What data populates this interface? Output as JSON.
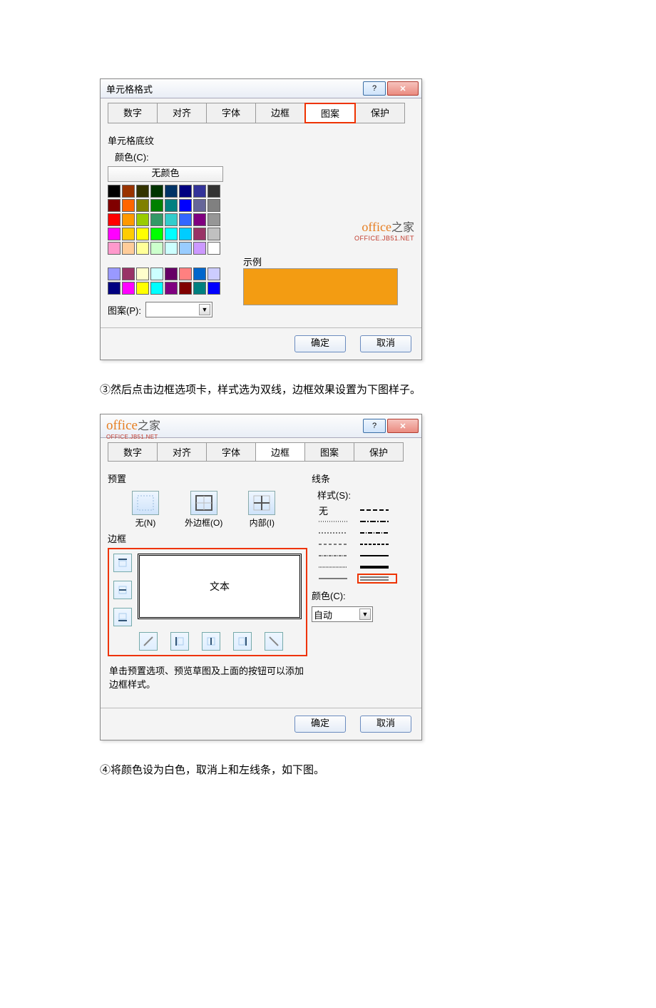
{
  "dialog1": {
    "title": "单元格格式",
    "tabs": [
      "数字",
      "对齐",
      "字体",
      "边框",
      "图案",
      "保护"
    ],
    "activeTab": "图案",
    "shading_label": "单元格底纹",
    "color_label": "颜色(C):",
    "no_color_label": "无颜色",
    "pattern_label": "图案(P):",
    "example_label": "示例",
    "example_color": "#f39c12",
    "selected_swatch": "#f39c12",
    "ok_label": "确定",
    "cancel_label": "取消",
    "watermark_brand": "office",
    "watermark_brand_zh": "之家",
    "watermark_url": "OFFICE.JB51.NET",
    "palette1": [
      "#000000",
      "#993300",
      "#333300",
      "#003300",
      "#003366",
      "#000080",
      "#333399",
      "#333333",
      "#800000",
      "#ff6600",
      "#808000",
      "#008000",
      "#008080",
      "#0000ff",
      "#666699",
      "#808080",
      "#ff0000",
      "#ff9900",
      "#99cc00",
      "#339966",
      "#33cccc",
      "#3366ff",
      "#800080",
      "#969696",
      "#ff00ff",
      "#ffcc00",
      "#ffff00",
      "#00ff00",
      "#00ffff",
      "#00ccff",
      "#993366",
      "#c0c0c0",
      "#ff99cc",
      "#ffcc99",
      "#ffff99",
      "#ccffcc",
      "#ccffff",
      "#99ccff",
      "#cc99ff",
      "#ffffff"
    ],
    "palette2": [
      "#9999ff",
      "#993366",
      "#ffffcc",
      "#ccffff",
      "#660066",
      "#ff8080",
      "#0066cc",
      "#ccccff",
      "#000080",
      "#ff00ff",
      "#ffff00",
      "#00ffff",
      "#800080",
      "#800000",
      "#008080",
      "#0000ff"
    ]
  },
  "instruction1": "③然后点击边框选项卡，样式选为双线，边框效果设置为下图样子。",
  "dialog2": {
    "tabs": [
      "数字",
      "对齐",
      "字体",
      "边框",
      "图案",
      "保护"
    ],
    "activeTab": "边框",
    "preset_label": "预置",
    "preset_none": "无(N)",
    "preset_outline": "外边框(O)",
    "preset_inside": "内部(I)",
    "border_label": "边框",
    "preview_text": "文本",
    "line_label": "线条",
    "style_label": "样式(S):",
    "style_none": "无",
    "color_label": "颜色(C):",
    "color_auto": "自动",
    "hint": "单击预置选项、预览草图及上面的按钮可以添加边框样式。",
    "ok_label": "确定",
    "cancel_label": "取消",
    "watermark_brand": "office",
    "watermark_brand_zh": "之家",
    "watermark_url": "OFFICE.JB51.NET"
  },
  "instruction2": "④将颜色设为白色，取消上和左线条，如下图。"
}
